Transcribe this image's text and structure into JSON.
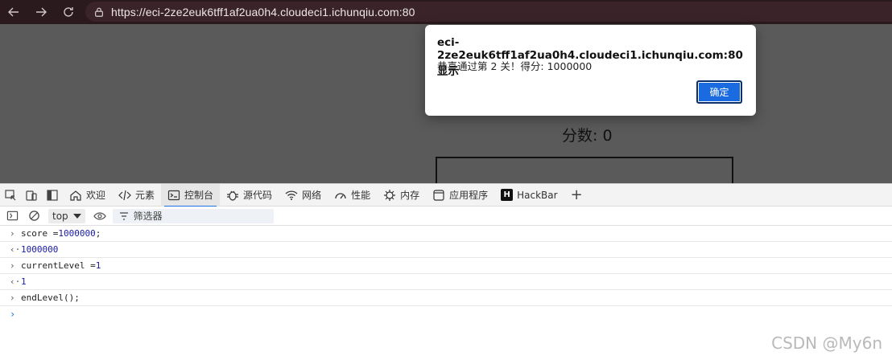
{
  "browser": {
    "url": "https://eci-2ze2euk6tff1af2ua0h4.cloudeci1.ichunqiu.com:80"
  },
  "page": {
    "score_label": "分数: 0"
  },
  "alert": {
    "title": "eci-2ze2euk6tff1af2ua0h4.cloudeci1.ichunqiu.com:80 显示",
    "message": "恭喜通过第 2 关！得分: 1000000",
    "ok_label": "确定"
  },
  "devtools": {
    "tabs": [
      {
        "label": "欢迎",
        "icon": "home-icon"
      },
      {
        "label": "元素",
        "icon": "code-icon"
      },
      {
        "label": "控制台",
        "icon": "console-icon"
      },
      {
        "label": "源代码",
        "icon": "bug-icon"
      },
      {
        "label": "网络",
        "icon": "wifi-icon"
      },
      {
        "label": "性能",
        "icon": "gauge-icon"
      },
      {
        "label": "内存",
        "icon": "memory-chip-icon"
      },
      {
        "label": "应用程序",
        "icon": "application-icon"
      },
      {
        "label": "HackBar",
        "icon": "hackbar-icon"
      }
    ],
    "hackbar_letter": "H",
    "plus": "+",
    "context": "top",
    "filter_placeholder": "筛选器"
  },
  "console": {
    "entries": [
      {
        "type": "input",
        "code": "score = ",
        "value": "1000000",
        "suffix": ";"
      },
      {
        "type": "output",
        "value": "1000000"
      },
      {
        "type": "input",
        "code": "currentLevel = ",
        "value": "1",
        "suffix": ""
      },
      {
        "type": "output",
        "value": "1"
      },
      {
        "type": "input",
        "code": "endLevel();",
        "value": "",
        "suffix": ""
      }
    ],
    "input_arrow": "›",
    "output_arrow": "‹·",
    "prompt": "›"
  },
  "watermark": "CSDN @My6n",
  "colors": {
    "accent": "#1a73e8",
    "alert_button": "#1b6be0",
    "topbar": "#2a1a1d"
  }
}
